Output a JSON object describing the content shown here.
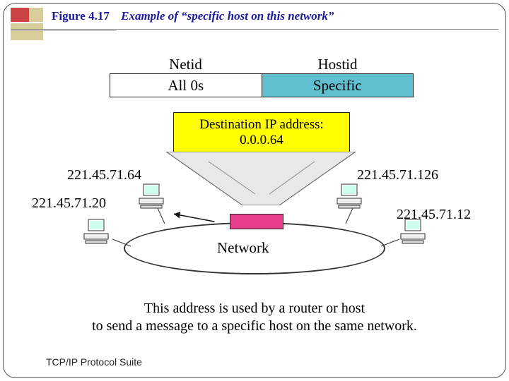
{
  "figure": {
    "number": "Figure 4.17",
    "title": "Example of “specific host on this network”"
  },
  "address_bar": {
    "header_left": "Netid",
    "header_right": "Hostid",
    "cell_left": "All 0s",
    "cell_right": "Specific"
  },
  "destination": {
    "line1": "Destination IP address:",
    "line2": "0.0.0.64"
  },
  "hosts": {
    "h1": "221.45.71.64",
    "h2": "221.45.71.20",
    "h3": "221.45.71.126",
    "h4": "221.45.71.12"
  },
  "network_label": "Network",
  "caption": {
    "line1": "This address is used by a router or host",
    "line2": "to send a message to a specific host on the same network."
  },
  "footer": "TCP/IP Protocol Suite"
}
